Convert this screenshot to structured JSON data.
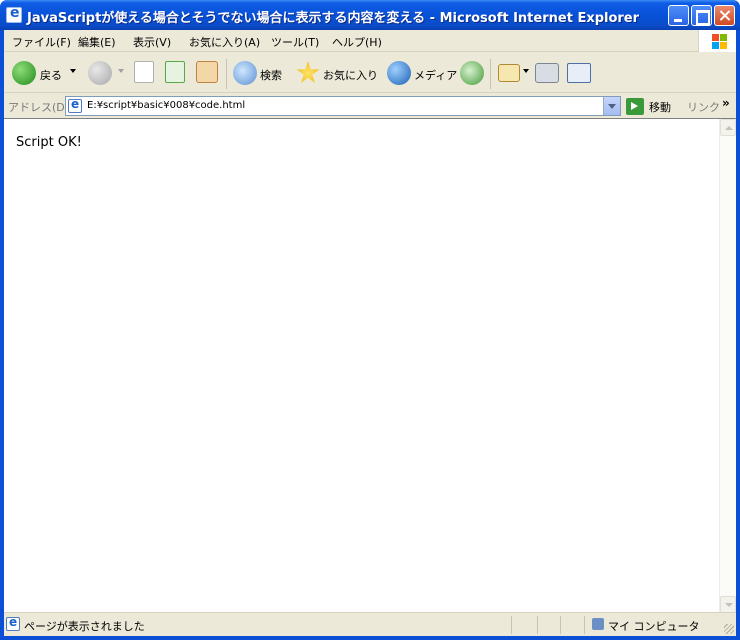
{
  "window": {
    "title": "JavaScriptが使える場合とそうでない場合に表示する内容を変える - Microsoft Internet Explorer"
  },
  "menubar": {
    "items": [
      "ファイル(F)",
      "編集(E)",
      "表示(V)",
      "お気に入り(A)",
      "ツール(T)",
      "ヘルプ(H)"
    ]
  },
  "toolbar": {
    "back_label": "戻る",
    "search_label": "検索",
    "favorites_label": "お気に入り",
    "media_label": "メディア"
  },
  "addressbar": {
    "label": "アドレス(D)",
    "url": "E:¥script¥basic¥008¥code.html",
    "go_label": "移動",
    "links_label": "リンク"
  },
  "content": {
    "text": "Script OK!"
  },
  "statusbar": {
    "status_text": "ページが表示されました",
    "zone_text": "マイ コンピュータ"
  }
}
